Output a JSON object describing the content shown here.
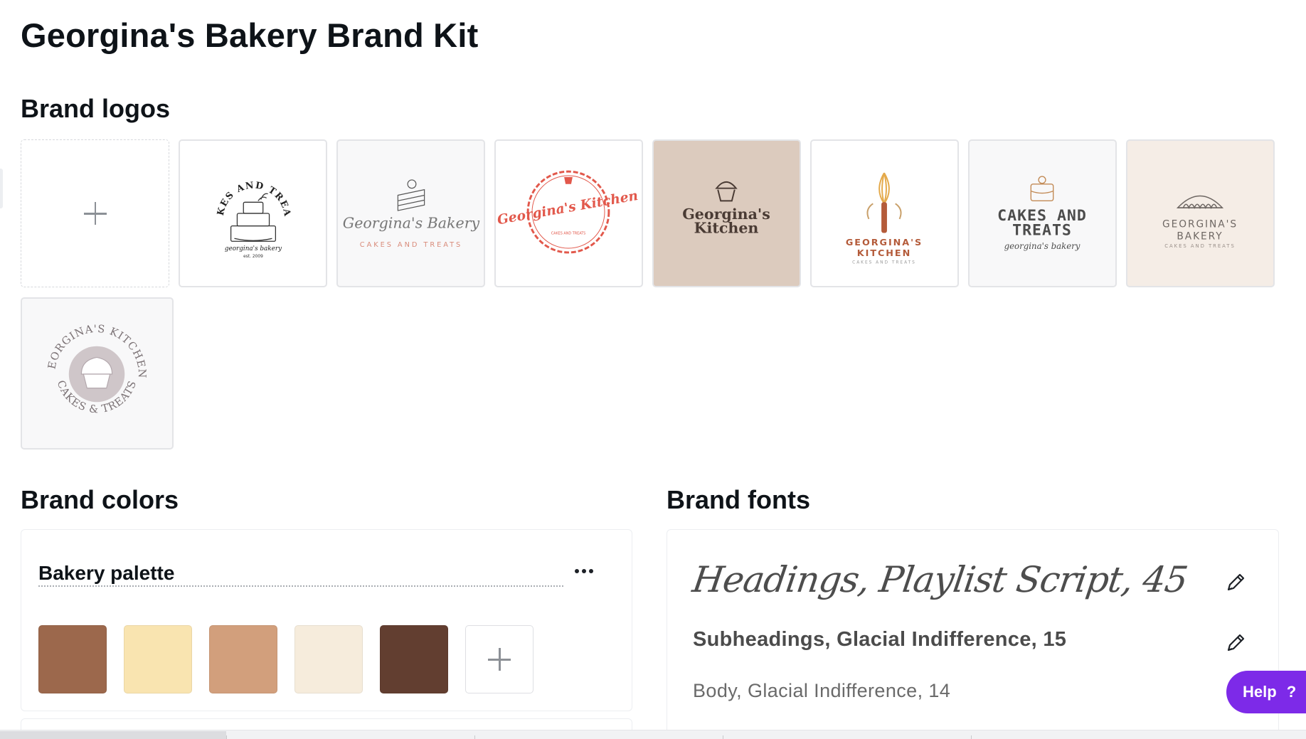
{
  "page": {
    "title": "Georgina's Bakery Brand Kit"
  },
  "logos": {
    "heading": "Brand logos",
    "add_icon": "plus-icon",
    "items": [
      {
        "alt": "cakes-and-treats-tiered-cake-logo",
        "arc_text": "CAKES AND TREATS",
        "script_text": "georgina's bakery",
        "sub_text": "est. 2009"
      },
      {
        "alt": "georginas-bakery-cake-slice-logo",
        "script_text": "Georgina's Bakery",
        "sub_text": "CAKES AND TREATS"
      },
      {
        "alt": "georginas-kitchen-red-badge-logo",
        "script_text": "Georgina's Kitchen",
        "sub_text": "CAKES AND TREATS"
      },
      {
        "alt": "georginas-kitchen-cupcake-beige-logo",
        "line1": "Georgina's",
        "line2": "Kitchen"
      },
      {
        "alt": "georginas-kitchen-whisk-logo",
        "line1": "GEORGINA'S",
        "line2": "KITCHEN",
        "sub_text": "CAKES AND TREATS"
      },
      {
        "alt": "cakes-and-treats-stencil-logo",
        "line1": "CAKES AND",
        "line2": "TREATS",
        "script_text": "georgina's bakery"
      },
      {
        "alt": "georginas-bakery-pie-logo",
        "line1": "GEORGINA'S",
        "line2": "BAKERY",
        "sub_text": "CAKES AND TREATS"
      },
      {
        "alt": "georginas-kitchen-circular-cupcake-logo",
        "arc_top": "GEORGINA'S KITCHEN",
        "arc_bottom": "CAKES & TREATS"
      }
    ]
  },
  "colors": {
    "heading": "Brand colors",
    "palette_name": "Bakery palette",
    "more_icon": "more-horizontal-icon",
    "add_icon": "plus-icon",
    "swatches": [
      {
        "name": "brown",
        "hex": "#9C684C"
      },
      {
        "name": "cream-yellow",
        "hex": "#F9E4B0"
      },
      {
        "name": "tan",
        "hex": "#D29F7C"
      },
      {
        "name": "ivory",
        "hex": "#F6ECDC"
      },
      {
        "name": "dark-brown",
        "hex": "#623E30"
      }
    ]
  },
  "fonts": {
    "heading": "Brand fonts",
    "edit_icon": "pencil-icon",
    "items": [
      {
        "label": "Headings, Playlist Script, 45"
      },
      {
        "label": "Subheadings, Glacial Indifference, 15"
      },
      {
        "label": "Body, Glacial Indifference, 14"
      }
    ]
  },
  "help": {
    "label": "Help",
    "glyph": "?",
    "accent": "#7D2AE8"
  }
}
